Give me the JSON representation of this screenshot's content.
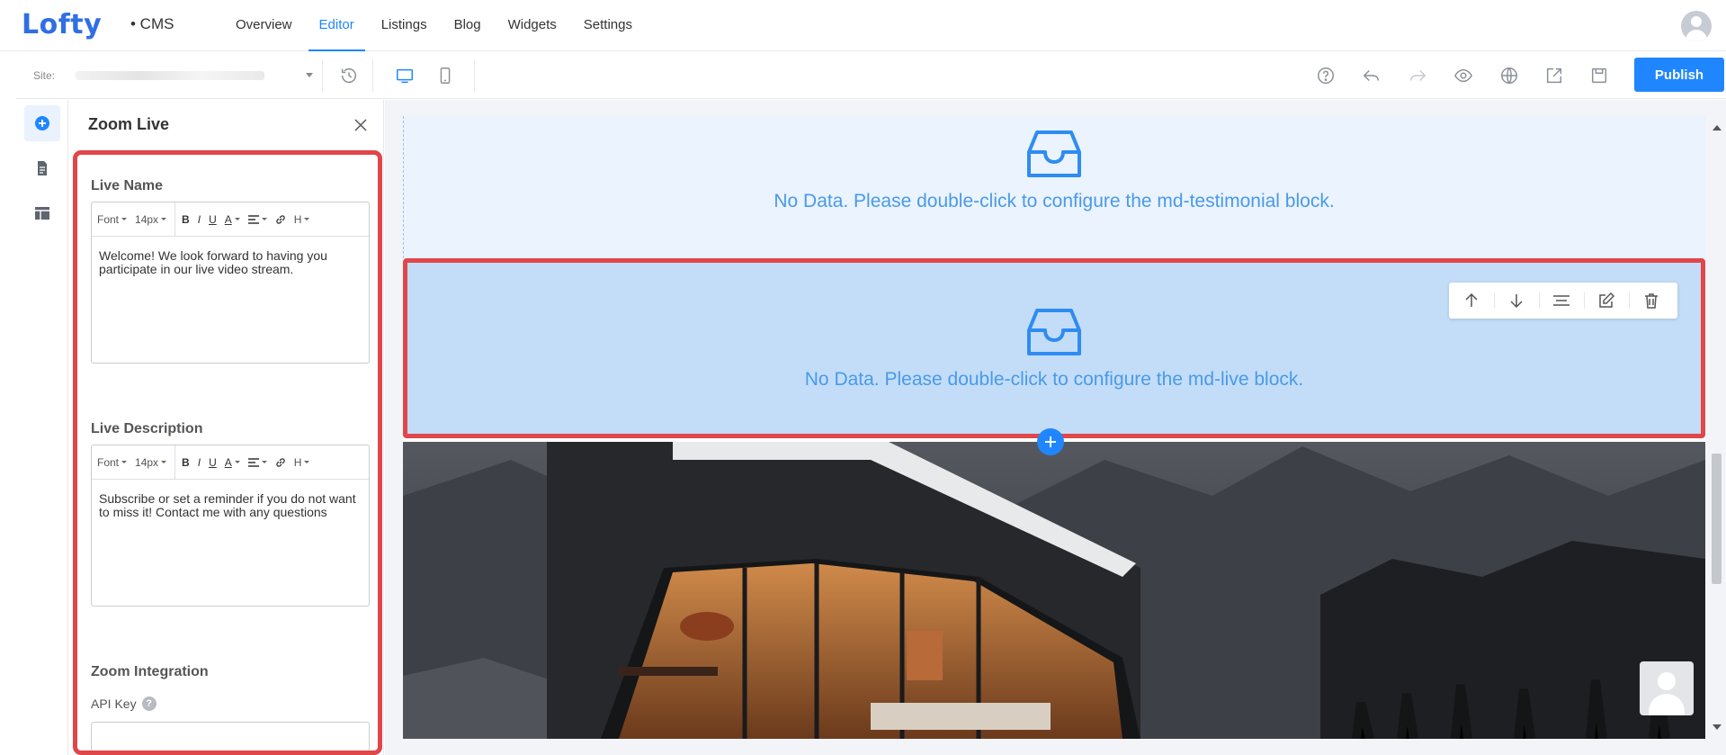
{
  "app": {
    "logo": "Lofty",
    "product": "• CMS",
    "nav": [
      "Overview",
      "Editor",
      "Listings",
      "Blog",
      "Widgets",
      "Settings"
    ],
    "active_nav": "Editor"
  },
  "toolbar": {
    "site_label": "Site:",
    "publish_label": "Publish",
    "icons": [
      "history-icon",
      "desktop-icon",
      "mobile-icon",
      "help-icon",
      "undo-icon",
      "redo-icon",
      "preview-icon",
      "globe-icon",
      "export-icon",
      "save-icon"
    ]
  },
  "rail": {
    "icons": [
      "add-icon",
      "page-icon",
      "layout-icon"
    ]
  },
  "panel": {
    "title": "Zoom Live",
    "live_name_label": "Live Name",
    "live_name_text": "Welcome! We look forward to having you participate in our live video stream.",
    "live_description_label": "Live Description",
    "live_description_text": "Subscribe or set a reminder if you do not want to miss it! Contact me with any questions",
    "zoom_integration_label": "Zoom Integration",
    "api_key_label": "API Key",
    "api_key_value": "",
    "editor_toolbar": {
      "font": "Font",
      "size": "14px",
      "bold": "B",
      "italic": "I",
      "underline": "U",
      "color": "A",
      "heading": "H"
    }
  },
  "canvas": {
    "block1_message": "No Data. Please double-click to configure the md-testimonial block.",
    "block2_message": "No Data. Please double-click to configure the md-live block.",
    "block_tools": [
      "move-up-icon",
      "move-down-icon",
      "align-icon",
      "edit-icon",
      "delete-icon"
    ]
  },
  "colors": {
    "accent": "#1f86ff",
    "logo": "#2f6fe4",
    "highlight": "#e0464a",
    "block_selected": "#c3ddf8",
    "block_idle": "#eaf3fe",
    "message": "#4a9ae8"
  }
}
